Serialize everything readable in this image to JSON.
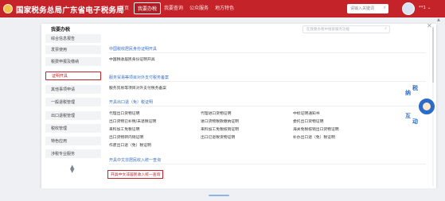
{
  "header": {
    "brand": "国家税务总局广东省电子税务局",
    "logo_icon": "tax-emblem-icon",
    "nav": [
      {
        "label": "首页",
        "active": false
      },
      {
        "label": "我要办税",
        "active": true
      },
      {
        "label": "我要查询",
        "active": false
      },
      {
        "label": "公众服务",
        "active": false
      },
      {
        "label": "地方特色",
        "active": false
      }
    ],
    "search_placeholder": "请输入关键词",
    "user_name": "**1 ⌄"
  },
  "sidebar": {
    "title": "我要办税",
    "items": [
      {
        "label": "综合信息报告",
        "active": false
      },
      {
        "label": "发票使用",
        "active": false
      },
      {
        "label": "税费申报及缴纳",
        "active": false
      },
      {
        "label": "证明开具",
        "active": true
      },
      {
        "label": "其他事项申请",
        "active": false
      },
      {
        "label": "一般退税管理",
        "active": false
      },
      {
        "label": "出口退税管理",
        "active": false
      },
      {
        "label": "税收管理",
        "active": false
      },
      {
        "label": "特色应用",
        "active": false
      },
      {
        "label": "涉税专业服务",
        "active": false
      }
    ]
  },
  "content": {
    "search_placeholder": "在我要办税中搜索服务功能",
    "sections": [
      {
        "title": "中国税收居民身份证明开具",
        "links": [
          "中国税收居民身份证明开具"
        ]
      },
      {
        "title": "服务贸易等项目对外支付税务备案",
        "links": [
          "服务贸易等项目对外支付税务备案"
        ]
      },
      {
        "title": "开具出口退（免）税证明",
        "links": [
          "代理出口货物证明",
          "代理进口货物证明",
          "中标证明通知书",
          "出口货物已补税/未退税证明",
          "进口货物税款缴纳证明",
          "委托出口货物证明",
          "来料加工免税证明",
          "来料加工免税核销证明",
          "海关免税核销出口货物证明",
          "出口货物转内销证明",
          "出口已退税货物证明",
          "补办出口退（免）税证明",
          "作废出口退（免）税证明"
        ]
      },
      {
        "title": "开具中文非居民收入统一查询",
        "links": [
          "开具中文非居民收入统一查询"
        ]
      }
    ]
  },
  "assistant": {
    "line1": "纳",
    "line2": "税",
    "line3": "互",
    "line4": "动"
  },
  "colors": {
    "brand_red": "#c5232a",
    "section_blue": "#3a6fc4",
    "page_bg": "#eef0f3"
  }
}
